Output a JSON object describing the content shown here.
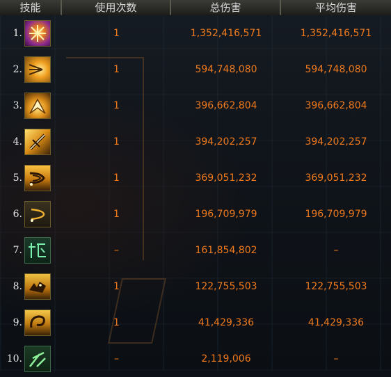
{
  "columns": {
    "skill": "技能",
    "uses": "使用次数",
    "total": "总伤害",
    "average": "平均伤害"
  },
  "rows": [
    {
      "rank": "1.",
      "icon": "purple-burst-icon",
      "uses": "1",
      "total": "1,352,416,571",
      "average": "1,352,416,571"
    },
    {
      "rank": "2.",
      "icon": "gold-star-burst-icon",
      "uses": "1",
      "total": "594,748,080",
      "average": "594,748,080"
    },
    {
      "rank": "3.",
      "icon": "gold-flash-icon",
      "uses": "1",
      "total": "396,662,804",
      "average": "396,662,804"
    },
    {
      "rank": "4.",
      "icon": "gold-blade-icon",
      "uses": "1",
      "total": "394,202,257",
      "average": "394,202,257"
    },
    {
      "rank": "5.",
      "icon": "gold-wave-slash-icon",
      "uses": "1",
      "total": "369,051,232",
      "average": "369,051,232"
    },
    {
      "rank": "6.",
      "icon": "crescent-slash-icon",
      "uses": "1",
      "total": "196,709,979",
      "average": "196,709,979"
    },
    {
      "rank": "7.",
      "icon": "green-rune-icon",
      "uses": "–",
      "total": "161,854,802",
      "average": "–"
    },
    {
      "rank": "8.",
      "icon": "gold-beast-icon",
      "uses": "1",
      "total": "122,755,503",
      "average": "122,755,503"
    },
    {
      "rank": "9.",
      "icon": "gold-swirl-icon",
      "uses": "1",
      "total": "41,429,336",
      "average": "41,429,336"
    },
    {
      "rank": "10.",
      "icon": "green-claw-icon",
      "uses": "–",
      "total": "2,119,006",
      "average": "–"
    }
  ],
  "colors": {
    "value_text": "#f07a1c",
    "header_text": "#d8d8d8",
    "rank_text": "#e6e6e6"
  }
}
